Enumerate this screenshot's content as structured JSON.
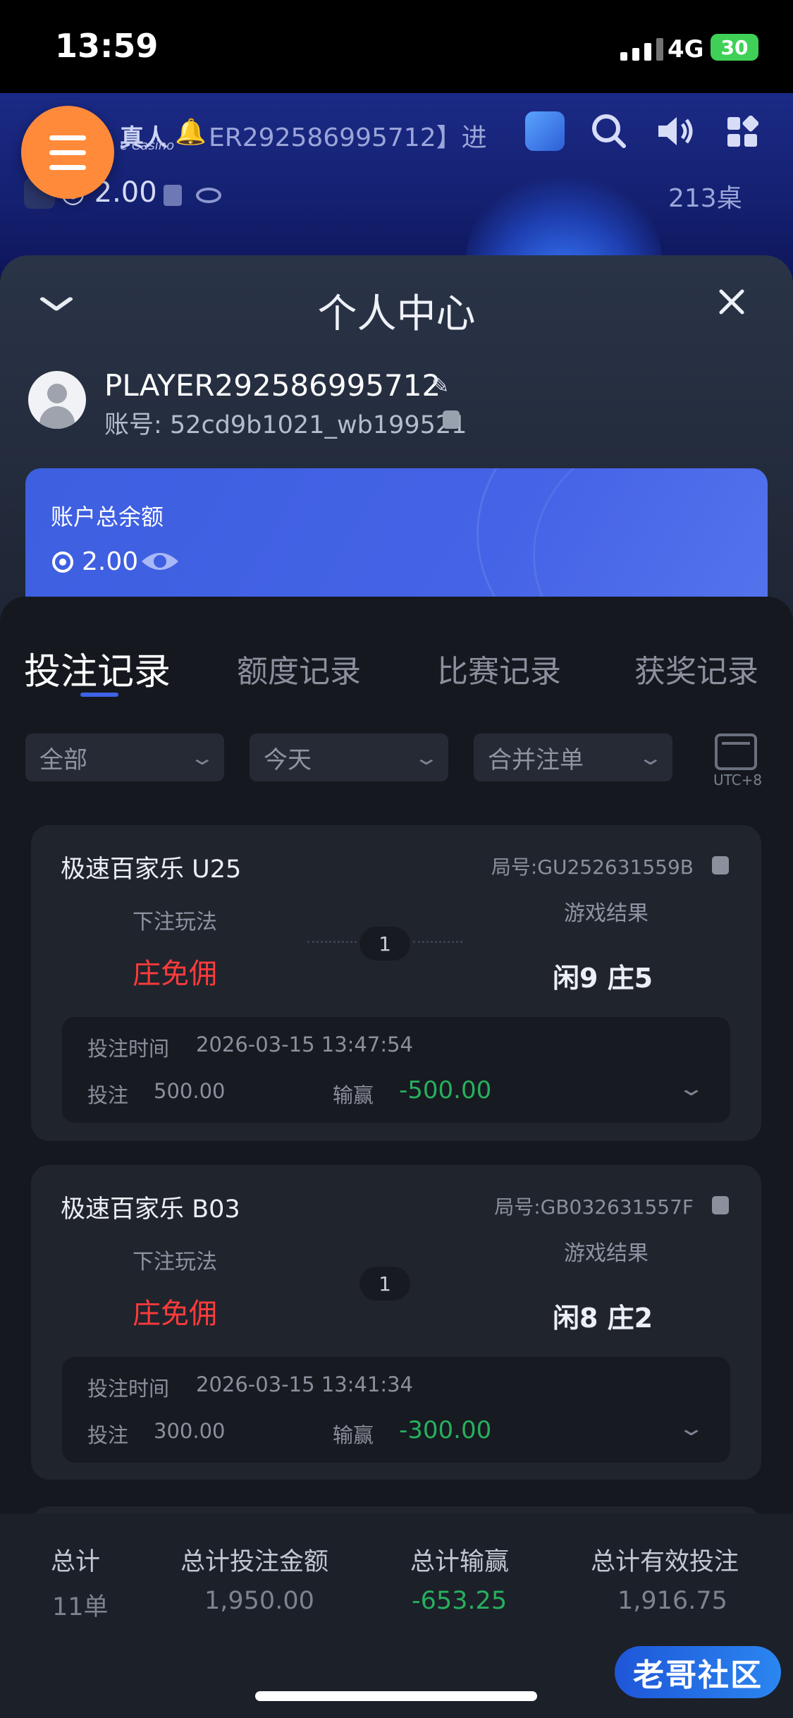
{
  "status_bar": {
    "time": "13:59",
    "network": "4G",
    "battery": "30"
  },
  "game_header": {
    "brand": "真人",
    "brand_sub": "e Casino",
    "marquee": "ER292586995712】进",
    "balance": "2.00",
    "tables": "213桌"
  },
  "panel": {
    "title": "个人中心",
    "player_name": "PLAYER292586995712",
    "account_line": "账号: 52cd9b1021_wb199521"
  },
  "balance_card": {
    "title": "账户总余额",
    "value": "2.00"
  },
  "tabs": [
    {
      "label": "投注记录",
      "active": true
    },
    {
      "label": "额度记录",
      "active": false
    },
    {
      "label": "比赛记录",
      "active": false
    },
    {
      "label": "获奖记录",
      "active": false
    }
  ],
  "filters": {
    "type": "全部",
    "date": "今天",
    "merge": "合并注单",
    "timezone": "UTC+8"
  },
  "records": [
    {
      "game": "极速百家乐 U25",
      "round": "局号:GU252631559B",
      "play_label": "下注玩法",
      "result_label": "游戏结果",
      "bet_type": "庄免佣",
      "badge": "1",
      "result": "闲9 庄5",
      "time_label": "投注时间",
      "time": "2026-03-15 13:47:54",
      "bet_label": "投注",
      "bet": "500.00",
      "winloss_label": "输赢",
      "winloss": "-500.00"
    },
    {
      "game": "极速百家乐 B03",
      "round": "局号:GB032631557F",
      "play_label": "下注玩法",
      "result_label": "游戏结果",
      "bet_type": "庄免佣",
      "badge": "1",
      "result": "闲8 庄2",
      "time_label": "投注时间",
      "time": "2026-03-15 13:41:34",
      "bet_label": "投注",
      "bet": "300.00",
      "winloss_label": "输赢",
      "winloss": "-300.00"
    }
  ],
  "summary": {
    "count_label": "总计",
    "count": "11单",
    "bet_total_label": "总计投注金额",
    "bet_total": "1,950.00",
    "winloss_label": "总计输赢",
    "winloss": "-653.25",
    "valid_label": "总计有效投注",
    "valid": "1,916.75"
  },
  "watermark": "老哥社区",
  "colors": {
    "accent_blue": "#3d63e6",
    "menu_orange": "#ff8a3a",
    "loss_green": "#27b05e",
    "bet_red": "#ff3b3b"
  }
}
